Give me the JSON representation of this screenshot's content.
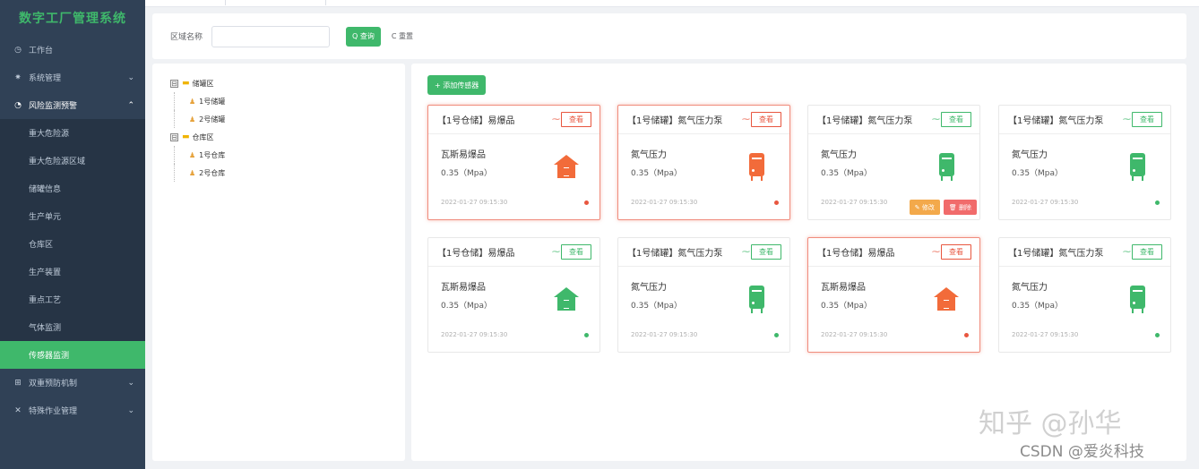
{
  "app": {
    "title": "数字工厂管理系统"
  },
  "sidebar": {
    "items": [
      {
        "icon": "◷",
        "label": "工作台"
      },
      {
        "icon": "✷",
        "label": "系统管理",
        "chevron": "⌄"
      },
      {
        "icon": "◔",
        "label": "风险监测预警",
        "chevron": "⌃"
      }
    ],
    "sub_items": [
      "重大危险源",
      "重大危险源区域",
      "储罐信息",
      "生产单元",
      "仓库区",
      "生产装置",
      "重点工艺",
      "气体监测",
      "传感器监测"
    ],
    "items_after": [
      {
        "icon": "⊞",
        "label": "双重预防机制",
        "chevron": "⌄"
      },
      {
        "icon": "✕",
        "label": "特殊作业管理",
        "chevron": "⌄"
      }
    ]
  },
  "search": {
    "label": "区域名称",
    "placeholder": "",
    "query_label": "Q 查询",
    "reset_label": "C 重置"
  },
  "tree": {
    "groups": [
      {
        "expander": "⊟",
        "label": "储罐区",
        "children": [
          "1号储罐",
          "2号储罐"
        ]
      },
      {
        "expander": "⊟",
        "label": "仓库区",
        "children": [
          "1号仓库",
          "2号仓库"
        ]
      }
    ]
  },
  "toolbar": {
    "add_label": "+ 添加传感器"
  },
  "cards": [
    {
      "title": "【1号仓储】易爆品",
      "name": "瓦斯易爆品",
      "value": "0.35（Mpa）",
      "time": "2022-01-27 09:15:30",
      "view": "查看",
      "icon": "house",
      "alarm": true
    },
    {
      "title": "【1号储罐】氮气压力泵",
      "name": "氮气压力",
      "value": "0.35（Mpa）",
      "time": "2022-01-27 09:15:30",
      "view": "查看",
      "icon": "tank",
      "alarm": true
    },
    {
      "title": "【1号储罐】氮气压力泵",
      "name": "氮气压力",
      "value": "0.35（Mpa）",
      "time": "2022-01-27 09:15:30",
      "view": "查看",
      "icon": "tank",
      "alarm": false,
      "hover": true
    },
    {
      "title": "【1号储罐】氮气压力泵",
      "name": "氮气压力",
      "value": "0.35（Mpa）",
      "time": "2022-01-27 09:15:30",
      "view": "查看",
      "icon": "tank",
      "alarm": false
    },
    {
      "title": "【1号仓储】易爆品",
      "name": "瓦斯易爆品",
      "value": "0.35（Mpa）",
      "time": "2022-01-27 09:15:30",
      "view": "查看",
      "icon": "house",
      "alarm": false
    },
    {
      "title": "【1号储罐】氮气压力泵",
      "name": "氮气压力",
      "value": "0.35（Mpa）",
      "time": "2022-01-27 09:15:30",
      "view": "查看",
      "icon": "tank",
      "alarm": false
    },
    {
      "title": "【1号仓储】易爆品",
      "name": "瓦斯易爆品",
      "value": "0.35（Mpa）",
      "time": "2022-01-27 09:15:30",
      "view": "查看",
      "icon": "house",
      "alarm": true
    },
    {
      "title": "【1号储罐】氮气压力泵",
      "name": "氮气压力",
      "value": "0.35（Mpa）",
      "time": "2022-01-27 09:15:30",
      "view": "查看",
      "icon": "tank",
      "alarm": false
    }
  ],
  "card_actions": {
    "edit_label": "✎ 修改",
    "delete_label": "🗑 删除"
  },
  "watermark": {
    "line1": "知乎 @孙华",
    "line2": "CSDN @爱炎科技"
  },
  "colors": {
    "accent": "#3fb86b",
    "alarm": "#e8563f",
    "sidebar_bg": "#304156"
  }
}
